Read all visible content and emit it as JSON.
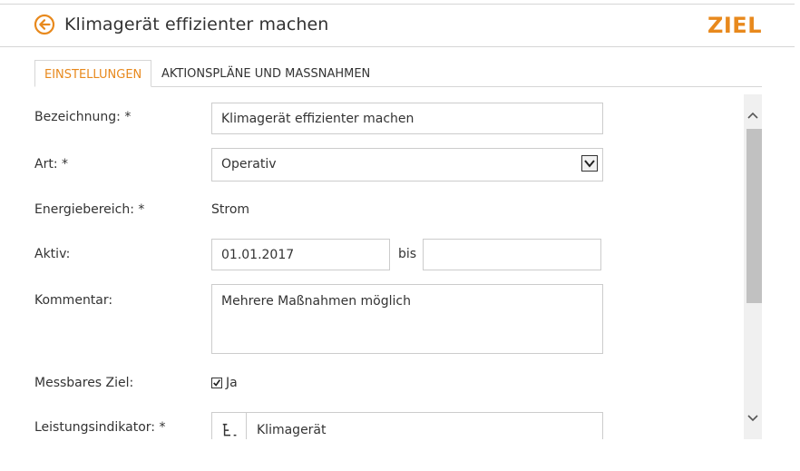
{
  "header": {
    "title": "Klimagerät effizienter machen",
    "type_label": "ZIEL",
    "back_icon": "arrow-left-circle-icon",
    "accent_color": "#e8891d"
  },
  "tabs": [
    {
      "label": "EINSTELLUNGEN",
      "active": true
    },
    {
      "label": "AKTIONSPLÄNE UND MASSNAHMEN",
      "active": false
    }
  ],
  "form": {
    "bezeichnung": {
      "label": "Bezeichnung: *",
      "value": "Klimagerät effizienter machen"
    },
    "art": {
      "label": "Art: *",
      "value": "Operativ"
    },
    "energiebereich": {
      "label": "Energiebereich: *",
      "value": "Strom"
    },
    "aktiv": {
      "label": "Aktiv:",
      "from": "01.01.2017",
      "separator": "bis",
      "to": ""
    },
    "kommentar": {
      "label": "Kommentar:",
      "value": "Mehrere Maßnahmen möglich"
    },
    "messbares_ziel": {
      "label": "Messbares Ziel:",
      "checked": true,
      "option": "Ja"
    },
    "leistungsindikator": {
      "label": "Leistungsindikator: *",
      "value": "Klimagerät",
      "icon": "hierarchy-tree-icon"
    }
  }
}
